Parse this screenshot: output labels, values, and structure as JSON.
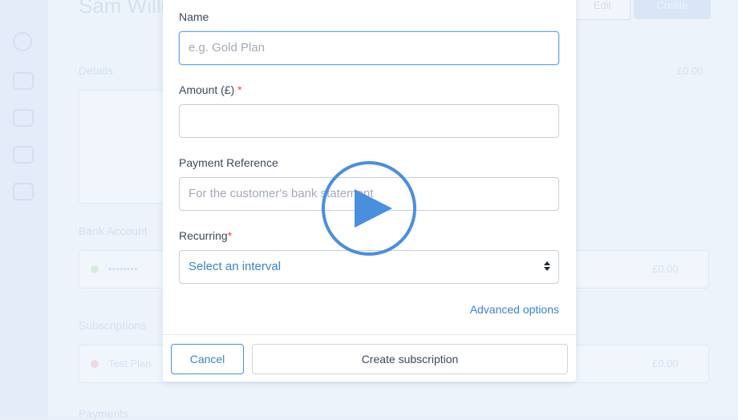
{
  "background": {
    "title": "Sam Willi",
    "buttons": [
      "Edit",
      "Create"
    ],
    "sections": [
      "Details",
      "Bank Account",
      "Subscriptions",
      "Payments"
    ],
    "side_values": [
      "£0.00",
      "£0.00",
      "£0.00"
    ],
    "rows": [
      "••••••••",
      "Test Plan"
    ]
  },
  "form": {
    "name": {
      "label": "Name",
      "placeholder": "e.g. Gold Plan"
    },
    "amount": {
      "label": "Amount (£)",
      "required_mark": "*"
    },
    "reference": {
      "label": "Payment Reference",
      "placeholder": "For the customer's bank statement"
    },
    "recurring": {
      "label": "Recurring",
      "required_mark": "*",
      "selected": "Select an interval"
    },
    "advanced_link": "Advanced options",
    "cancel_label": "Cancel",
    "create_label": "Create subscription"
  },
  "colors": {
    "accent": "#3a85cf",
    "play": "#4a8fde"
  }
}
